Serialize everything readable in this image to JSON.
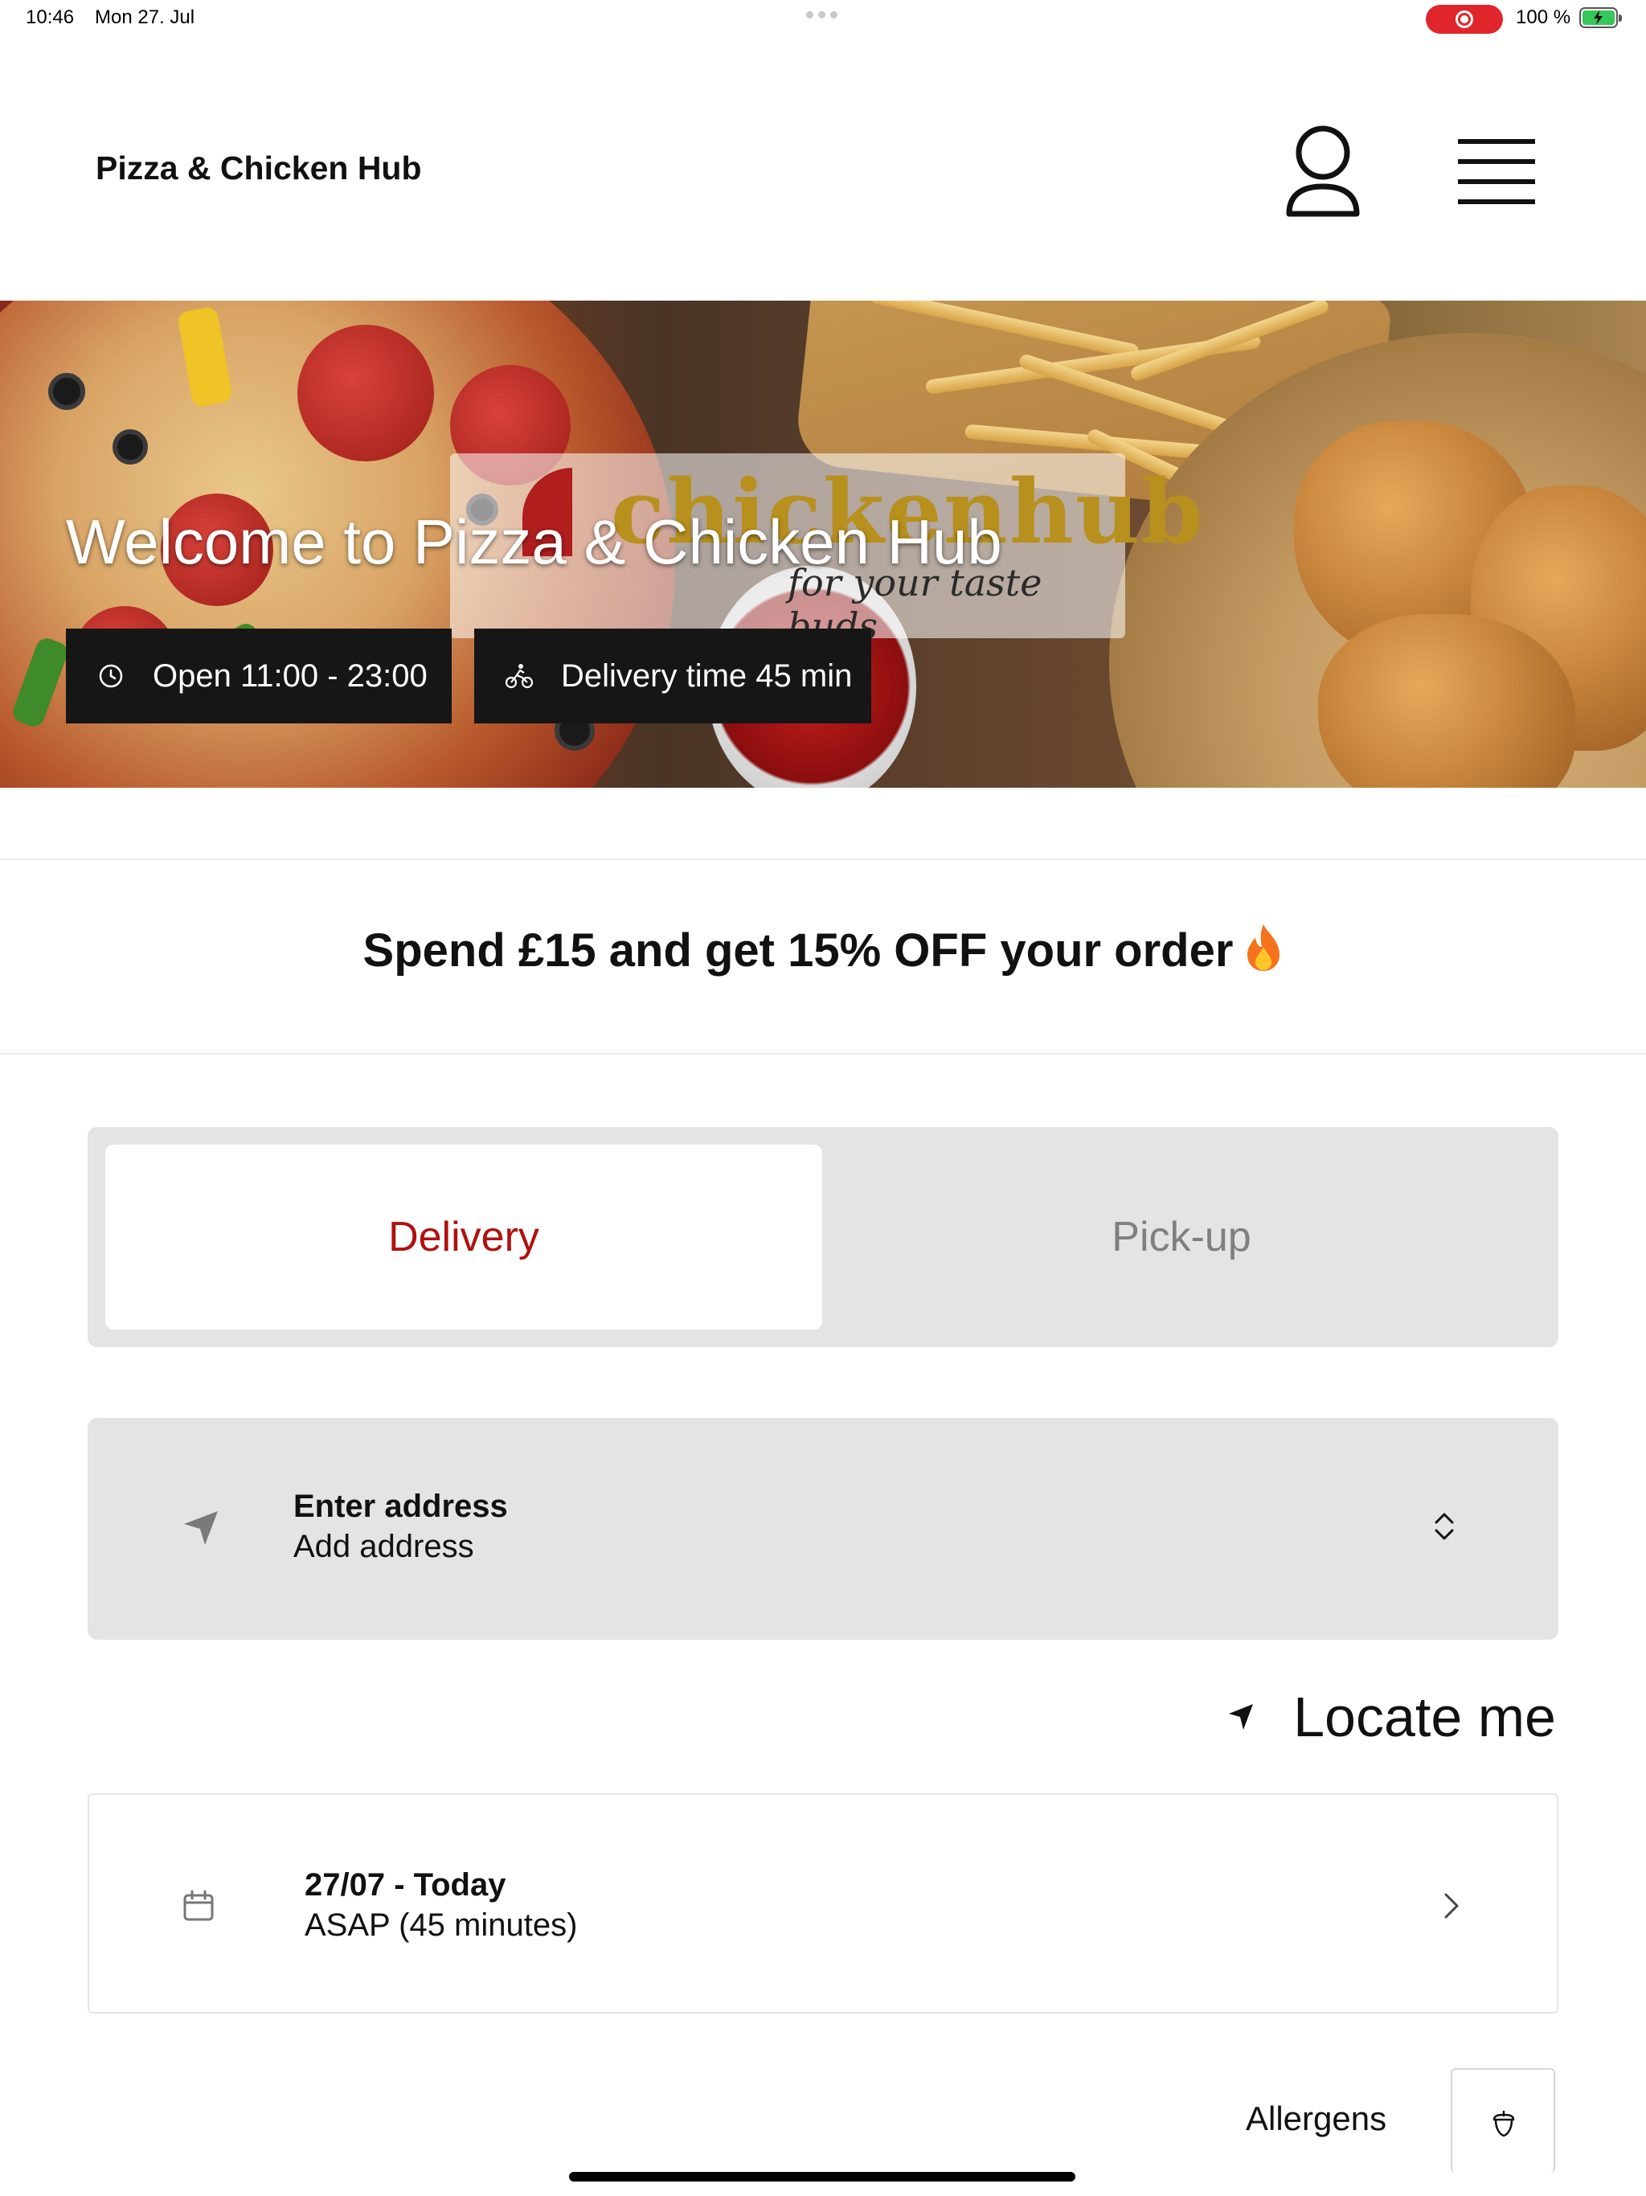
{
  "status_bar": {
    "time": "10:46",
    "date": "Mon 27. Jul",
    "battery": "100 %",
    "recording_color": "#e0262b",
    "battery_color": "#34c759"
  },
  "header": {
    "brand": "Pizza & Chicken Hub",
    "profile_icon": "person-icon",
    "menu_icon": "hamburger-menu-icon"
  },
  "hero": {
    "title": "Welcome to Pizza & Chicken Hub",
    "logo_text": "chickenhub",
    "logo_tagline": "for your taste buds",
    "open_hours": "Open 11:00 - 23:00",
    "delivery_time": "Delivery time 45 min"
  },
  "promo": {
    "text": "Spend £15 and get 15% OFF your order"
  },
  "order_mode": {
    "options": [
      "Delivery",
      "Pick-up"
    ],
    "selected": "Delivery",
    "accent": "#b0100f"
  },
  "address": {
    "title": "Enter address",
    "placeholder": "Add address"
  },
  "locate": {
    "label": "Locate me"
  },
  "schedule": {
    "date": "27/07 - Today",
    "time": "ASAP (45 minutes)"
  },
  "allergens": {
    "label": "Allergens"
  }
}
